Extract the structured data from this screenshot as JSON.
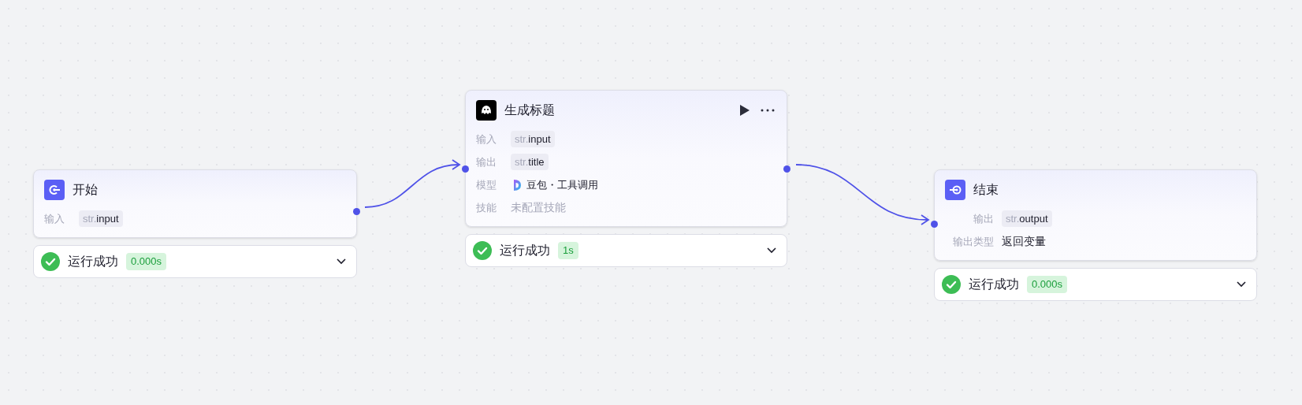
{
  "nodes": [
    {
      "kind": "start",
      "title": "开始",
      "rows": [
        {
          "label": "输入",
          "kind": "var",
          "type": "str.",
          "name": "input"
        }
      ],
      "status": {
        "text": "运行成功",
        "time": "0.000s"
      }
    },
    {
      "kind": "llm",
      "title": "生成标题",
      "rows": [
        {
          "label": "输入",
          "kind": "var",
          "type": "str.",
          "name": "input"
        },
        {
          "label": "输出",
          "kind": "var",
          "type": "str.",
          "name": "title"
        },
        {
          "label": "模型",
          "kind": "model",
          "value": "豆包・工具调用"
        },
        {
          "label": "技能",
          "kind": "placeholder",
          "value": "未配置技能"
        }
      ],
      "status": {
        "text": "运行成功",
        "time": "1s"
      }
    },
    {
      "kind": "end",
      "title": "结束",
      "rows": [
        {
          "label": "输出",
          "kind": "var",
          "type": "str.",
          "name": "output"
        },
        {
          "label": "输出类型",
          "kind": "text",
          "value": "返回变量"
        }
      ],
      "status": {
        "text": "运行成功",
        "time": "0.000s"
      }
    }
  ]
}
